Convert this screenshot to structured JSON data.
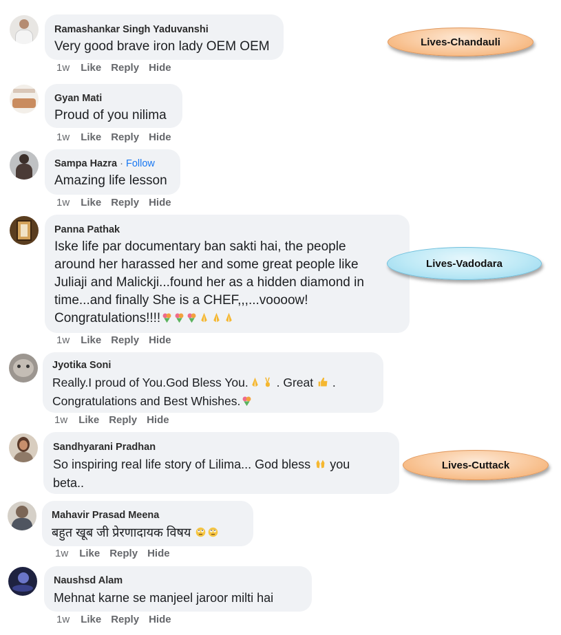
{
  "comments": [
    {
      "author": "Ramashankar Singh Yaduvanshi",
      "text": "Very good brave iron lady OEM OEM",
      "time": "1w",
      "like": "Like",
      "reply": "Reply",
      "hide": "Hide"
    },
    {
      "author": "Gyan Mati",
      "text": "Proud of you nilima",
      "time": "1w",
      "like": "Like",
      "reply": "Reply",
      "hide": "Hide"
    },
    {
      "author": "Sampa Hazra",
      "separator": "·",
      "follow": "Follow",
      "text": "Amazing life lesson",
      "time": "1w",
      "like": "Like",
      "reply": "Reply",
      "hide": "Hide"
    },
    {
      "author": "Panna Pathak",
      "text_lines": [
        "Iske life par documentary ban sakti hai, the people",
        "around her harassed her and some great people like",
        "Juliaji and Malickji...found her as a hidden diamond in",
        "time...and finally She is a CHEF,,,...voooow!",
        "Congratulations!!!!"
      ],
      "time": "1w",
      "like": "Like",
      "reply": "Reply",
      "hide": "Hide"
    },
    {
      "author": "Jyotika Soni",
      "text_lines": [
        "Really.I proud of You.God Bless You.",
        ". Great",
        ".",
        "Congratulations and Best Whishes."
      ],
      "time": "1w",
      "like": "Like",
      "reply": "Reply",
      "hide": "Hide"
    },
    {
      "author": "Sandhyarani Pradhan",
      "text_lines": [
        "So inspiring real life story of Lilima... God bless",
        "you",
        "beta.."
      ],
      "time": "",
      "like": "",
      "reply": "",
      "hide": ""
    },
    {
      "author": "Mahavir Prasad Meena",
      "text": "बहुत खूब जी प्रेरणादायक विषय",
      "time": "1w",
      "like": "Like",
      "reply": "Reply",
      "hide": "Hide"
    },
    {
      "author": "Naushsd Alam",
      "text": "Mehnat karne se manjeel jaroor milti hai",
      "time": "1w",
      "like": "Like",
      "reply": "Reply",
      "hide": "Hide"
    }
  ],
  "callouts": {
    "chandauli": "Lives-Chandauli",
    "vadodara": "Lives-Vadodara",
    "cuttack": "Lives-Cuttack"
  },
  "colors": {
    "bubble": "#f0f2f5",
    "follow_link": "#1877f2",
    "action_text": "#65676b",
    "callout_orange": "#f9c79a",
    "callout_blue": "#bde9f6"
  }
}
